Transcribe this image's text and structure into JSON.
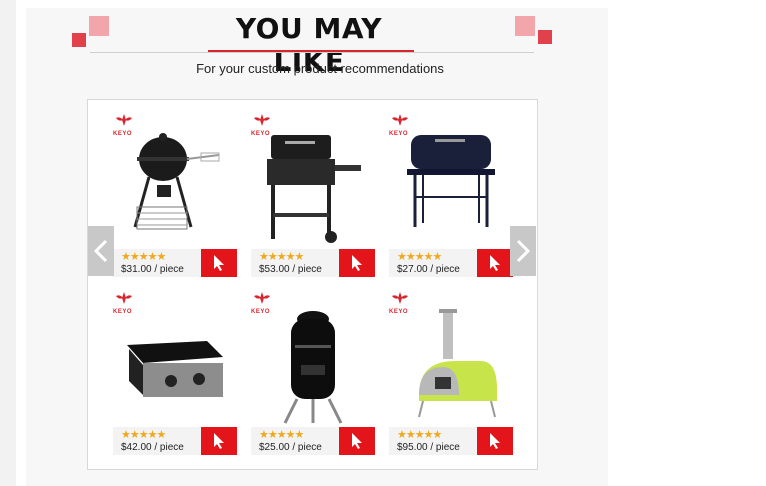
{
  "header": {
    "title": "YOU MAY LIKE",
    "subtitle": "For your custom product recommendations"
  },
  "colors": {
    "accent": "#d9262e",
    "deco_pink": "#f3a5ac",
    "button_red": "#e3141a",
    "star": "#f0a81c"
  },
  "brand": "KEYO",
  "products": [
    {
      "price": "$31.00 / piece",
      "rating": 5,
      "icon": "kettle-grill-icon"
    },
    {
      "price": "$53.00 / piece",
      "rating": 5,
      "icon": "charcoal-grill-icon"
    },
    {
      "price": "$27.00 / piece",
      "rating": 5,
      "icon": "barrel-grill-icon"
    },
    {
      "price": "$42.00 / piece",
      "rating": 5,
      "icon": "griddle-icon"
    },
    {
      "price": "$25.00 / piece",
      "rating": 5,
      "icon": "smoker-icon"
    },
    {
      "price": "$95.00 / piece",
      "rating": 5,
      "icon": "pizza-oven-icon"
    }
  ],
  "stars_text": "★★★★★",
  "nav": {
    "prev": "prev-arrow-icon",
    "next": "next-arrow-icon"
  }
}
